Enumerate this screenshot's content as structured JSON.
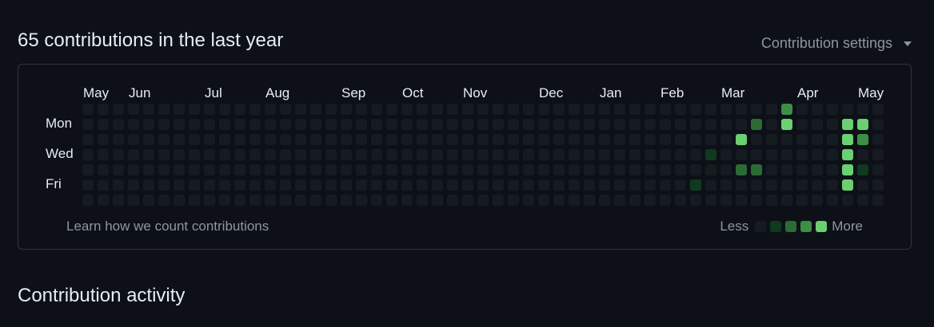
{
  "header": {
    "title": "65 contributions in the last year",
    "settings_label": "Contribution settings"
  },
  "calendar": {
    "months": [
      "May",
      "Jun",
      "Jul",
      "Aug",
      "Sep",
      "Oct",
      "Nov",
      "Dec",
      "Jan",
      "Feb",
      "Mar",
      "Apr",
      "May"
    ],
    "days": [
      "Mon",
      "Wed",
      "Fri"
    ],
    "levels": [
      "#161b22",
      "#0e4429",
      "#006d32",
      "#26a641",
      "#39d353"
    ],
    "cell_colors": [
      "#161a21",
      "#0f3a1f",
      "#2c6a36",
      "#3d8f46",
      "#6ad071"
    ],
    "active_cells": [
      {
        "week": 40,
        "day": 5,
        "level": 1
      },
      {
        "week": 41,
        "day": 3,
        "level": 1
      },
      {
        "week": 43,
        "day": 2,
        "level": 4
      },
      {
        "week": 43,
        "day": 4,
        "level": 2
      },
      {
        "week": 44,
        "day": 1,
        "level": 2
      },
      {
        "week": 44,
        "day": 4,
        "level": 2
      },
      {
        "week": 46,
        "day": 0,
        "level": 3
      },
      {
        "week": 46,
        "day": 1,
        "level": 4
      },
      {
        "week": 50,
        "day": 1,
        "level": 4
      },
      {
        "week": 50,
        "day": 2,
        "level": 4
      },
      {
        "week": 50,
        "day": 3,
        "level": 4
      },
      {
        "week": 50,
        "day": 4,
        "level": 4
      },
      {
        "week": 50,
        "day": 5,
        "level": 4
      },
      {
        "week": 51,
        "day": 1,
        "level": 4
      },
      {
        "week": 51,
        "day": 2,
        "level": 3
      },
      {
        "week": 51,
        "day": 4,
        "level": 1
      }
    ]
  },
  "footer": {
    "learn_link": "Learn how we count contributions",
    "less": "Less",
    "more": "More"
  },
  "activity": {
    "title": "Contribution activity"
  }
}
